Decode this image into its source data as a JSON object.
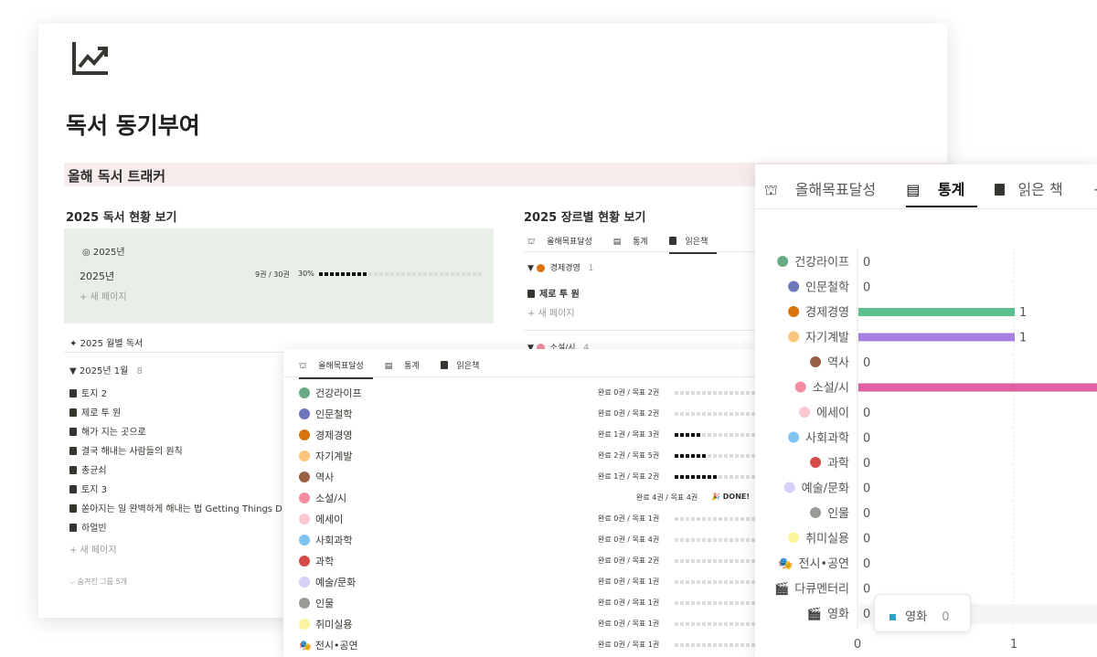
{
  "page": {
    "title": "독서 동기부여",
    "banner": "올해 독서 트래커"
  },
  "status": {
    "heading": "2025 독서 현황 보기",
    "tab_label": "2025년",
    "row_label": "2025년",
    "count": "9권 / 30권",
    "percent": "30%",
    "progress": 0.3,
    "new_page": "+ 새 페이지"
  },
  "monthly": {
    "heading": "2025 월별 독서",
    "group": "2025년 1월",
    "group_count": "8",
    "books": [
      "토지 2",
      "제로 투 원",
      "해가 지는 곳으로",
      "결국 해내는 사람들의 원칙",
      "총균쇠",
      "토지 3",
      "쏟아지는 일 완벽하게 해내는 법 Getting Things D",
      "하얼빈"
    ],
    "new_page": "+ 새 페이지",
    "hidden": "숨겨진 그룹 5개"
  },
  "genre": {
    "heading": "2025 장르별 현황 보기",
    "tabs": [
      "올해목표달성",
      "통계",
      "읽은책"
    ],
    "group1": "경제경영",
    "group1_count": "1",
    "book1": "제로 투 원",
    "new_page": "+ 새 페이지",
    "group2": "소설/시",
    "group2_count": "4"
  },
  "goals": {
    "tabs": [
      "올해목표달성",
      "통계",
      "읽은책"
    ],
    "rows": [
      {
        "name": "건강라이프",
        "color": "#6aaa82",
        "text": "완료 0권 / 목표 2권",
        "done": 0,
        "total": 2
      },
      {
        "name": "인문철학",
        "color": "#6b77b8",
        "text": "완료 0권 / 목표 2권",
        "done": 0,
        "total": 2
      },
      {
        "name": "경제경영",
        "color": "#d9730d",
        "text": "완료 1권 / 목표 3권",
        "done": 1,
        "total": 3
      },
      {
        "name": "자기계발",
        "color": "#fcc57e",
        "text": "완료 2권 / 목표 5권",
        "done": 2,
        "total": 5
      },
      {
        "name": "역사",
        "color": "#9a6046",
        "text": "완료 1권 / 목표 2권",
        "done": 1,
        "total": 2
      },
      {
        "name": "소설/시",
        "color": "#f28da0",
        "text": "완료 4권 / 목표 4권",
        "done": 4,
        "total": 4,
        "badge": "🎉 DONE!"
      },
      {
        "name": "에세이",
        "color": "#fbc7d0",
        "text": "완료 0권 / 목표 1권",
        "done": 0,
        "total": 1
      },
      {
        "name": "사회과학",
        "color": "#7ec4ef",
        "text": "완료 0권 / 목표 4권",
        "done": 0,
        "total": 4
      },
      {
        "name": "과학",
        "color": "#d44c47",
        "text": "완료 0권 / 목표 2권",
        "done": 0,
        "total": 2
      },
      {
        "name": "예술/문화",
        "color": "#d6cff7",
        "text": "완료 0권 / 목표 1권",
        "done": 0,
        "total": 1
      },
      {
        "name": "인물",
        "color": "#9b9a97",
        "text": "완료 0권 / 목표 1권",
        "done": 0,
        "total": 1
      },
      {
        "name": "취미실용",
        "color": "#fbf5a0",
        "text": "완료 0권 / 목표 1권",
        "done": 0,
        "total": 1
      },
      {
        "name": "전시•공연",
        "color": "#444444",
        "text": "완료 0권 / 목표 1권",
        "done": 0,
        "total": 1,
        "icon": "theater-icon"
      }
    ]
  },
  "stats": {
    "tabs": [
      "올해목표달성",
      "통계",
      "읽은 책",
      "+"
    ],
    "tooltip": {
      "label": "영화",
      "value": "0",
      "color": "#2aa3c7"
    },
    "axis_ticks": [
      "0",
      "1"
    ]
  },
  "chart_data": {
    "type": "bar",
    "orientation": "horizontal",
    "categories": [
      "건강라이프",
      "인문철학",
      "경제경영",
      "자기계발",
      "역사",
      "소설/시",
      "에세이",
      "사회과학",
      "과학",
      "예술/문화",
      "인물",
      "취미실용",
      "전시•공연",
      "다큐멘터리",
      "영화"
    ],
    "values": [
      0,
      0,
      1,
      1,
      0,
      4,
      0,
      0,
      0,
      0,
      0,
      0,
      0,
      0,
      0
    ],
    "colors": [
      "#6aaa82",
      "#6b77b8",
      "#d9730d",
      "#fcc57e",
      "#9a6046",
      "#f28da0",
      "#fbc7d0",
      "#7ec4ef",
      "#d44c47",
      "#d6cff7",
      "#9b9a97",
      "#fbf5a0",
      "#444444",
      "#444444",
      "#444444"
    ],
    "bar_colors": [
      "#6aaa82",
      "#6aaa82",
      "#5cc08d",
      "#a77fe0",
      "#6aaa82",
      "#e05fa0",
      "#6aaa82",
      "#6aaa82",
      "#6aaa82",
      "#6aaa82",
      "#6aaa82",
      "#6aaa82",
      "#6aaa82",
      "#6aaa82",
      "#6aaa82"
    ],
    "xlim": [
      0,
      1
    ],
    "grid": true,
    "legend": "none"
  }
}
